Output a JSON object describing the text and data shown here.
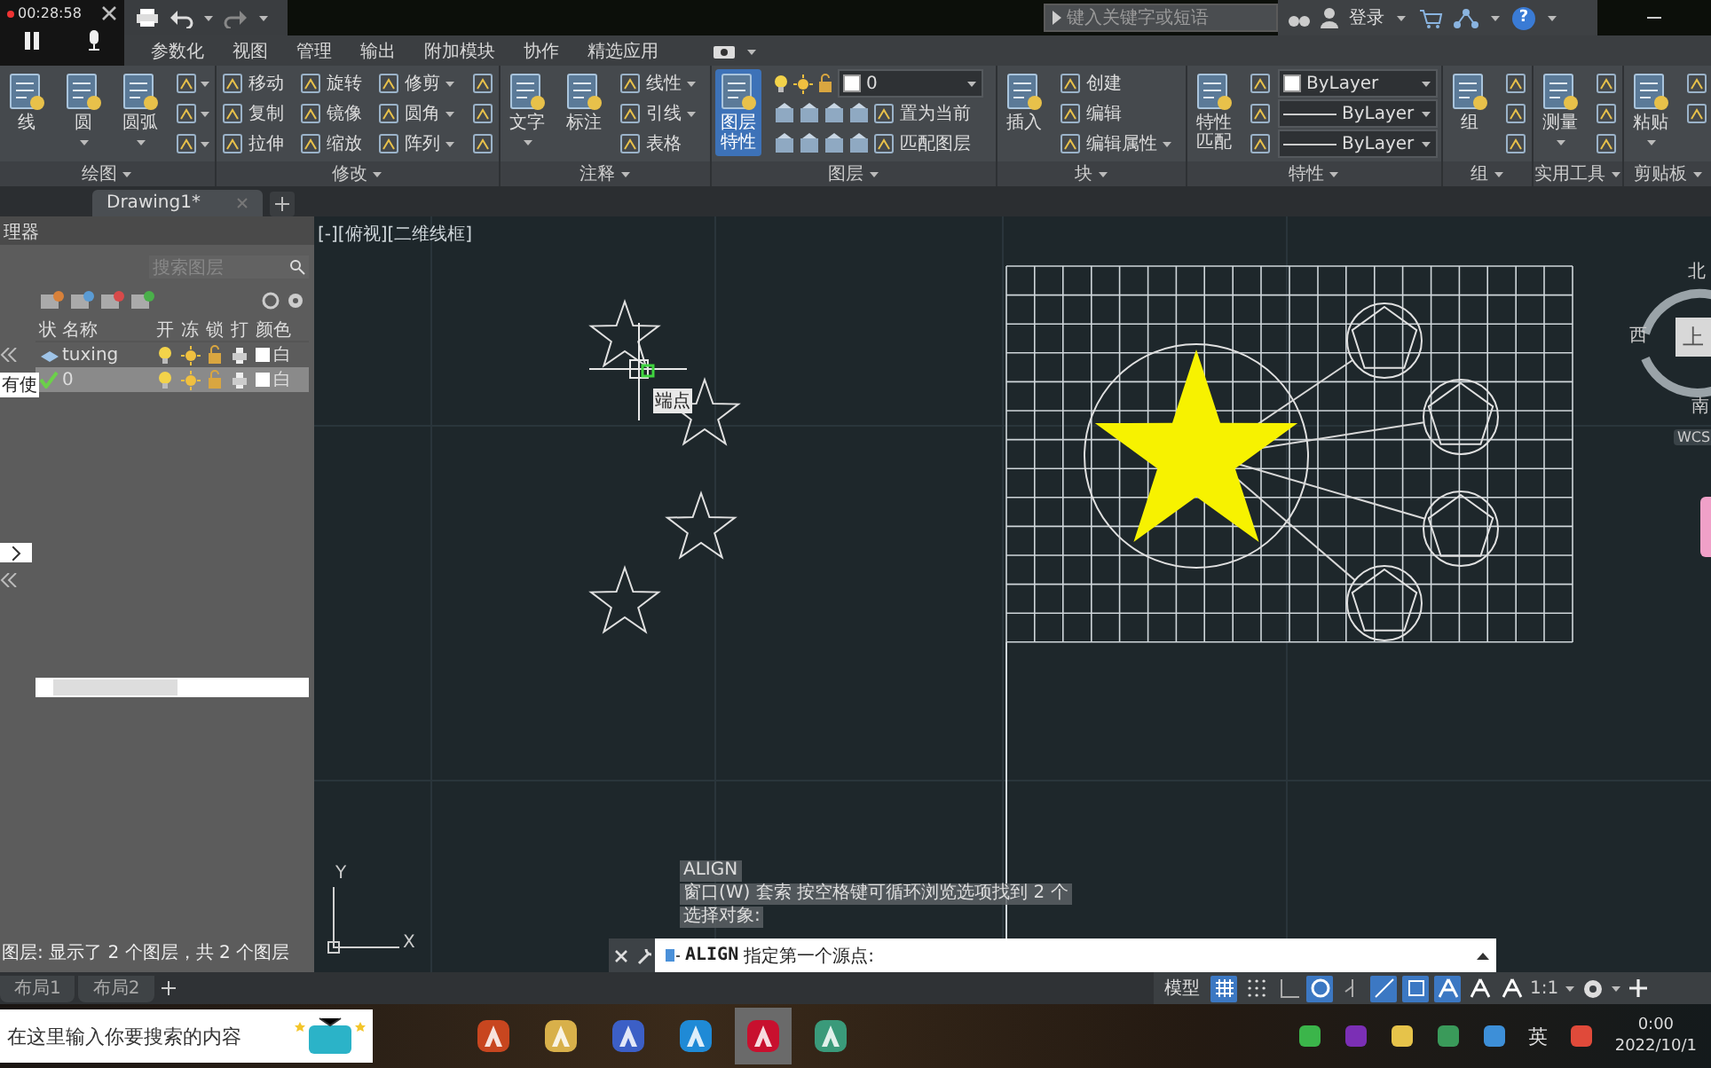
{
  "recorder": {
    "time": "00:28:58"
  },
  "title_bar": {
    "search": {
      "placeholder": "键入关键字或短语"
    },
    "account": "登录",
    "help": "?"
  },
  "menu_tabs": [
    {
      "label": "参数化",
      "selected": false
    },
    {
      "label": "视图",
      "selected": false
    },
    {
      "label": "管理",
      "selected": false
    },
    {
      "label": "输出",
      "selected": false
    },
    {
      "label": "附加模块",
      "selected": false
    },
    {
      "label": "协作",
      "selected": false
    },
    {
      "label": "精选应用",
      "selected": false
    }
  ],
  "ribbon": {
    "panels": [
      {
        "title": "绘图",
        "groups": [
          {
            "items": [
              {
                "kind": "large",
                "label": "线",
                "selected": false,
                "menu": false
              }
            ]
          },
          {
            "items": [
              {
                "kind": "large",
                "label": "圆",
                "selected": false,
                "menu": true
              }
            ]
          },
          {
            "items": [
              {
                "kind": "large",
                "label": "圆弧",
                "selected": false,
                "menu": true
              }
            ]
          },
          {
            "items": [
              {
                "kind": "icon",
                "menu": true
              },
              {
                "kind": "icon",
                "menu": true
              },
              {
                "kind": "icon",
                "menu": true
              }
            ]
          }
        ]
      },
      {
        "title": "修改",
        "groups": [
          {
            "items": [
              {
                "kind": "small",
                "label": "移动",
                "menu": false
              },
              {
                "kind": "small",
                "label": "复制",
                "menu": false
              },
              {
                "kind": "small",
                "label": "拉伸",
                "menu": false
              }
            ]
          },
          {
            "items": [
              {
                "kind": "small",
                "label": "旋转",
                "menu": false
              },
              {
                "kind": "small",
                "label": "镜像",
                "menu": false
              },
              {
                "kind": "small",
                "label": "缩放",
                "menu": false
              }
            ]
          },
          {
            "items": [
              {
                "kind": "small",
                "label": "修剪",
                "menu": true
              },
              {
                "kind": "small",
                "label": "圆角",
                "menu": true
              },
              {
                "kind": "small",
                "label": "阵列",
                "menu": true
              }
            ]
          },
          {
            "items": [
              {
                "kind": "icon",
                "menu": false
              },
              {
                "kind": "icon",
                "menu": false
              },
              {
                "kind": "icon",
                "menu": false
              }
            ]
          }
        ]
      },
      {
        "title": "注释",
        "groups": [
          {
            "items": [
              {
                "kind": "large",
                "label": "文字",
                "selected": false,
                "menu": true
              }
            ]
          },
          {
            "items": [
              {
                "kind": "large",
                "label": "标注",
                "selected": false,
                "menu": false
              }
            ]
          },
          {
            "items": [
              {
                "kind": "small",
                "label": "线性",
                "menu": true
              },
              {
                "kind": "small",
                "label": "引线",
                "menu": true
              },
              {
                "kind": "small",
                "label": "表格",
                "menu": false
              }
            ]
          }
        ]
      },
      {
        "title": "图层",
        "groups": [
          {
            "items": [
              {
                "kind": "large",
                "label": "图层特性",
                "selected": true,
                "menu": false
              }
            ]
          },
          {
            "items": [
              {
                "kind": "layer_dropdown",
                "value": "0"
              },
              {
                "kind": "layer_tools",
                "label": "置为当前",
                "menu": false
              },
              {
                "kind": "layer_tools",
                "label": "匹配图层",
                "menu": false
              }
            ]
          }
        ]
      },
      {
        "title": "块",
        "groups": [
          {
            "items": [
              {
                "kind": "large",
                "label": "插入",
                "selected": false,
                "menu": false
              }
            ]
          },
          {
            "items": [
              {
                "kind": "small",
                "label": "创建",
                "menu": false
              },
              {
                "kind": "small",
                "label": "编辑",
                "menu": false
              },
              {
                "kind": "small",
                "label": "编辑属性",
                "menu": true
              }
            ]
          }
        ]
      },
      {
        "title": "特性",
        "groups": [
          {
            "items": [
              {
                "kind": "large",
                "label": "特性匹配",
                "selected": false,
                "menu": false
              }
            ]
          },
          {
            "items": [
              {
                "kind": "icon",
                "menu": false
              },
              {
                "kind": "icon",
                "menu": false
              },
              {
                "kind": "icon",
                "menu": false
              }
            ]
          },
          {
            "items": [
              {
                "kind": "color_dropdown",
                "value": "ByLayer"
              },
              {
                "kind": "line_dropdown",
                "value": "ByLayer"
              },
              {
                "kind": "line_dropdown",
                "value": "ByLayer"
              }
            ]
          }
        ]
      },
      {
        "title": "组",
        "groups": [
          {
            "items": [
              {
                "kind": "large",
                "label": "组",
                "selected": false,
                "menu": false
              }
            ]
          },
          {
            "items": [
              {
                "kind": "icon",
                "menu": false
              },
              {
                "kind": "icon",
                "menu": false
              },
              {
                "kind": "icon",
                "menu": false
              }
            ]
          }
        ]
      },
      {
        "title": "实用工具",
        "groups": [
          {
            "items": [
              {
                "kind": "large",
                "label": "测量",
                "selected": false,
                "menu": true
              }
            ]
          },
          {
            "items": [
              {
                "kind": "icon",
                "menu": false
              },
              {
                "kind": "icon",
                "menu": false
              },
              {
                "kind": "icon",
                "menu": false
              }
            ]
          }
        ]
      },
      {
        "title": "剪贴板",
        "groups": [
          {
            "items": [
              {
                "kind": "large",
                "label": "粘贴",
                "selected": false,
                "menu": true
              }
            ]
          },
          {
            "items": [
              {
                "kind": "icon",
                "menu": false
              },
              {
                "kind": "icon",
                "menu": false
              }
            ]
          }
        ]
      }
    ]
  },
  "file_tabs": [
    {
      "label": "Drawing1*",
      "selected": true
    }
  ],
  "layer_panel": {
    "title": "理器",
    "search": {
      "placeholder": "搜索图层"
    },
    "filter": "有使",
    "columns": [
      "状",
      "名称",
      "开",
      "冻",
      "锁",
      "打",
      "颜色"
    ],
    "layers": [
      {
        "name": "tuxing",
        "color_name": "白",
        "current": false,
        "selected": false
      },
      {
        "name": "0",
        "color_name": "白",
        "current": true,
        "selected": true
      }
    ],
    "footer": "图层: 显示了 2 个图层，共 2 个图层"
  },
  "viewport": {
    "label": "[-][俯视][二维线框]",
    "tooltip": "端点",
    "compass": {
      "north": "北",
      "west": "西",
      "top": "上",
      "south": "南",
      "wcs": "WCS"
    },
    "ucs": {
      "x": "X",
      "y": "Y"
    }
  },
  "command_history": [
    "ALIGN",
    "窗口(W) 套索  按空格键可循环浏览选项找到 2 个",
    "选择对象:"
  ],
  "command_line": {
    "command": "ALIGN",
    "prompt": "指定第一个源点:"
  },
  "layout_tabs": [
    {
      "label": "布局1",
      "selected": false
    },
    {
      "label": "布局2",
      "selected": false
    }
  ],
  "status_bar": {
    "space": "模型",
    "toggles": [
      {
        "kind": "grid",
        "on": true
      },
      {
        "kind": "snap",
        "on": false
      },
      {
        "kind": "ortho",
        "on": false
      },
      {
        "kind": "polar",
        "on": true
      },
      {
        "kind": "iso",
        "on": false
      },
      {
        "kind": "track",
        "on": true
      },
      {
        "kind": "osnap",
        "on": true
      },
      {
        "kind": "annotate",
        "on": true
      },
      {
        "kind": "annotate",
        "on": false
      },
      {
        "kind": "annotate",
        "on": false
      }
    ],
    "scale": "1:1"
  },
  "taskbar": {
    "search": {
      "placeholder": "在这里输入你要搜索的内容"
    },
    "apps": [
      {
        "color": "#c8461f",
        "selected": false
      },
      {
        "color": "#d8b04a",
        "selected": false
      },
      {
        "color": "#3c5fc6",
        "selected": false
      },
      {
        "color": "#1f8ad6",
        "selected": false
      },
      {
        "color": "#c8102e",
        "selected": true
      },
      {
        "color": "#3a9a7a",
        "selected": false
      }
    ],
    "tray": [
      {
        "kind": "icon",
        "color": "#3bb54a"
      },
      {
        "kind": "icon",
        "color": "#7b2fb5"
      },
      {
        "kind": "icon",
        "color": "#e6c34a"
      },
      {
        "kind": "icon",
        "color": "#3a9a5a"
      },
      {
        "kind": "icon",
        "color": "#3d8fd8"
      },
      {
        "kind": "text",
        "label": "英"
      },
      {
        "kind": "icon",
        "color": "#e04a3a"
      }
    ],
    "time": "0:00",
    "date": "2022/10/1"
  }
}
